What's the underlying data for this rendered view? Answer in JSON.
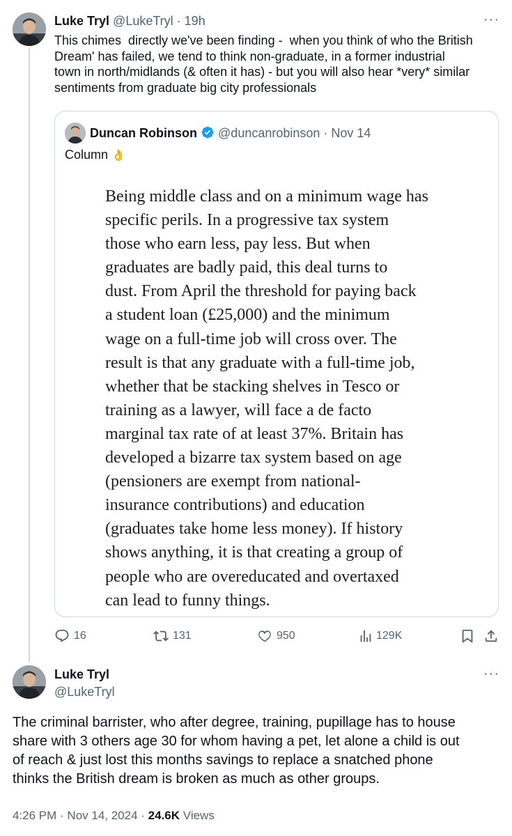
{
  "tweet": {
    "author_name": "Luke Tryl",
    "handle": "@LukeTryl",
    "time": "19h",
    "text_lines": [
      "This chimes  directly we've been finding -  when you think of who the British",
      "Dream' has failed, we tend to think non-graduate, in a former industrial",
      "town in north/midlands (& often it has) - but you will also hear *very* similar",
      "sentiments from graduate big city professionals"
    ],
    "more_icon": "···"
  },
  "quote": {
    "author_name": "Duncan Robinson",
    "handle": "@duncanrobinson",
    "date": "Nov 14",
    "text": "Column",
    "emoji": "👌",
    "column_lines": [
      "Being middle class and on a minimum wage has",
      "specific perils. In a progressive tax system",
      "those who earn less, pay less. But when",
      "graduates are badly paid, this deal turns to",
      "dust. From April the threshold for paying back",
      "a student loan (£25,000) and the minimum",
      "wage on a full-time job will cross over. The",
      "result is that any graduate with a full-time job,",
      "whether that be stacking shelves in Tesco or",
      "training as a lawyer, will face a de facto",
      "marginal tax rate of at least 37%. Britain has",
      "developed a bizarre tax system based on age",
      "(pensioners are exempt from national-",
      "insurance contributions) and education",
      "(graduates take home less money). If history",
      "shows anything, it is that creating a group of",
      "people who are overeducated and overtaxed",
      "can lead to funny things."
    ]
  },
  "actions": {
    "replies": "16",
    "reposts": "131",
    "likes": "950",
    "views": "129K"
  },
  "reply": {
    "author_name": "Luke Tryl",
    "handle": "@LukeTryl",
    "text_lines": [
      "The criminal barrister, who after degree, training, pupillage has to house",
      "share with 3 others age 30 for whom having a pet, let alone a child is out",
      "of reach & just lost this months savings to replace a snatched phone",
      "thinks the British dream is broken as much as other groups."
    ],
    "time": "4:26 PM",
    "date": "Nov 14, 2024",
    "views_count": "24.6K",
    "views_label": "Views",
    "more_icon": "···"
  },
  "colors": {
    "text": "#0f1419",
    "muted": "#536471",
    "border": "#cfd9de",
    "verified": "#1d9bf0"
  }
}
